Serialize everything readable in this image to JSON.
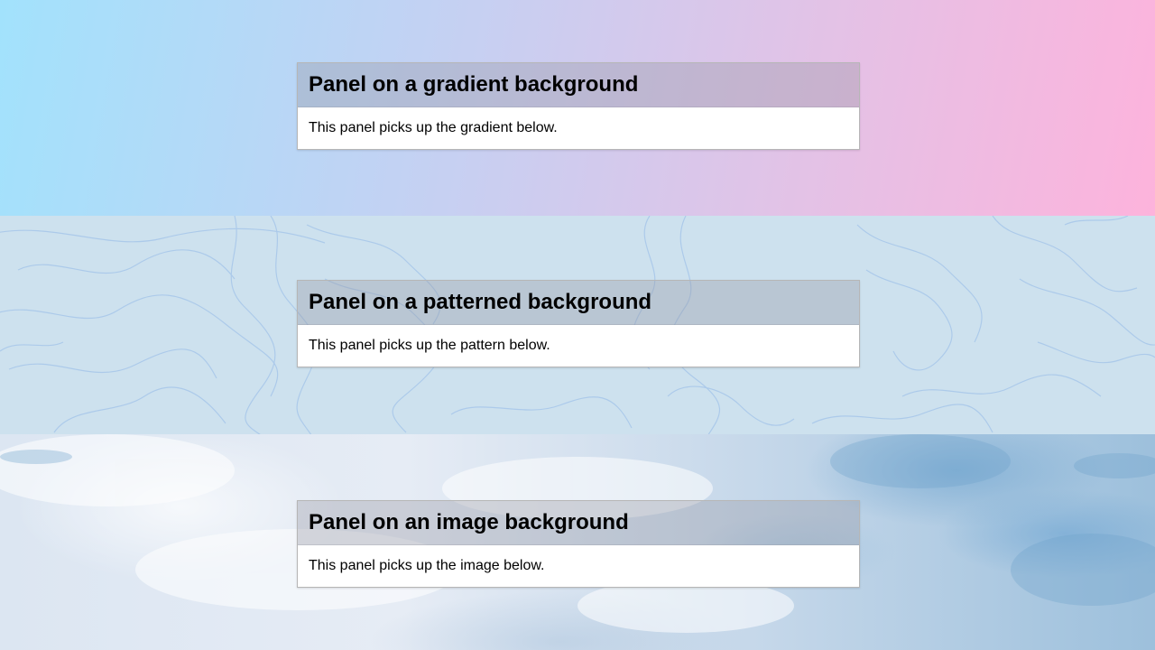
{
  "sections": [
    {
      "id": "gradient",
      "panel_title": "Panel on a gradient background",
      "panel_body": "This panel picks up the gradient below."
    },
    {
      "id": "pattern",
      "panel_title": "Panel on a patterned background",
      "panel_body": "This panel picks up the pattern below."
    },
    {
      "id": "image",
      "panel_title": "Panel on an image background",
      "panel_body": "This panel picks up the image below."
    }
  ],
  "colors": {
    "gradient_start": "#a2e2fc",
    "gradient_end": "#fdb3dc",
    "pattern_bg": "#cde1ee",
    "pattern_lines": "#a9c8ea",
    "panel_body_bg": "#ffffff",
    "panel_border": "#b6b6b6"
  }
}
